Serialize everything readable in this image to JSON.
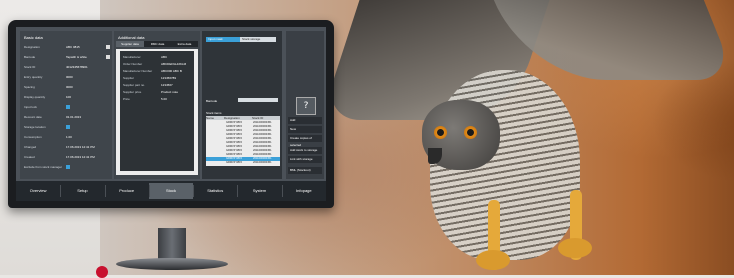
{
  "left_panel": {
    "title": "Basic data",
    "fields": [
      {
        "label": "Designation",
        "value": "ABC 0815"
      },
      {
        "label": "Barcode",
        "value": "Tapwith & white"
      },
      {
        "label": "Stock ID",
        "value": "4012345678901"
      },
      {
        "label": "Entry quantity",
        "value": "0000"
      },
      {
        "label": "Spacing",
        "value": "0000"
      },
      {
        "label": "Display quantity",
        "value": "100"
      },
      {
        "label": "Input lock",
        "value": ""
      },
      {
        "label": "Recount date",
        "value": "01.01.2013"
      },
      {
        "label": "Storage location",
        "value": ""
      },
      {
        "label": "Consumption",
        "value": "1.00"
      },
      {
        "label": "Changed",
        "value": "17.06.2013 12:41 PM"
      },
      {
        "label": "Created",
        "value": "17.06.2013 12:41 PM"
      },
      {
        "label": "Exclude from stock manager",
        "value": ""
      }
    ]
  },
  "mid_panel": {
    "title": "Additional data",
    "tabs": [
      "Supplier data",
      "RMC data",
      "Extra data"
    ],
    "rows": [
      {
        "label": "Manufacturer",
        "value": "ABC"
      },
      {
        "label": "Order Number",
        "value": "ABCDEFGHIJKLM"
      },
      {
        "label": "Manufacturer Number",
        "value": "ABC000 ABC B"
      },
      {
        "label": "Supplier",
        "value": "123456789"
      },
      {
        "label": "Supplier part no.",
        "value": "1234567"
      },
      {
        "label": "Supplier price",
        "value": "Product note"
      },
      {
        "label": "Price",
        "value": "5.00"
      }
    ]
  },
  "right_panel": {
    "tabs": [
      "Input mask",
      "Stock storage"
    ],
    "scanner_label": "Barcode",
    "stock_label": "Stock items",
    "table_headers": [
      "Name",
      "Designation",
      "Stock ID"
    ],
    "rows": [
      [
        "",
        "GRMVP 0815",
        "2011000000451"
      ],
      [
        "",
        "GRMVP 0815",
        "2011000000451"
      ],
      [
        "",
        "GRMVP 0815",
        "2011000000451"
      ],
      [
        "",
        "GRMVP 0815",
        "2011000000451"
      ],
      [
        "",
        "GRMVP 0815",
        "2011000000451"
      ],
      [
        "",
        "GRMVP 0815",
        "2011000000451"
      ],
      [
        "",
        "GRMVP 0815",
        "2011000000451"
      ],
      [
        "",
        "GRMVP 0815",
        "2011000000451"
      ],
      [
        "",
        "GRMVP 0815",
        "2011000000451"
      ],
      [
        "",
        "GRMVP 0815",
        "2011000000451"
      ],
      [
        "",
        "GRMVP 0815",
        "2011000000451"
      ]
    ]
  },
  "side_buttons": [
    "Add",
    "New",
    "Create copies of selected",
    "Add stock to storage",
    "Link with storage",
    "BML (Stockout)",
    "Add Subgroup",
    "Delete"
  ],
  "help_icon": "question-icon",
  "nav": [
    "Overview",
    "Setup",
    "Produce",
    "Stock",
    "Statistics",
    "System",
    "Infopage"
  ],
  "nav_active": "Stock",
  "colors": {
    "accent": "#3ba0d8",
    "screen_bg": "#4b5158",
    "nav_bg": "#23282d",
    "brand_red": "#c8102e"
  }
}
